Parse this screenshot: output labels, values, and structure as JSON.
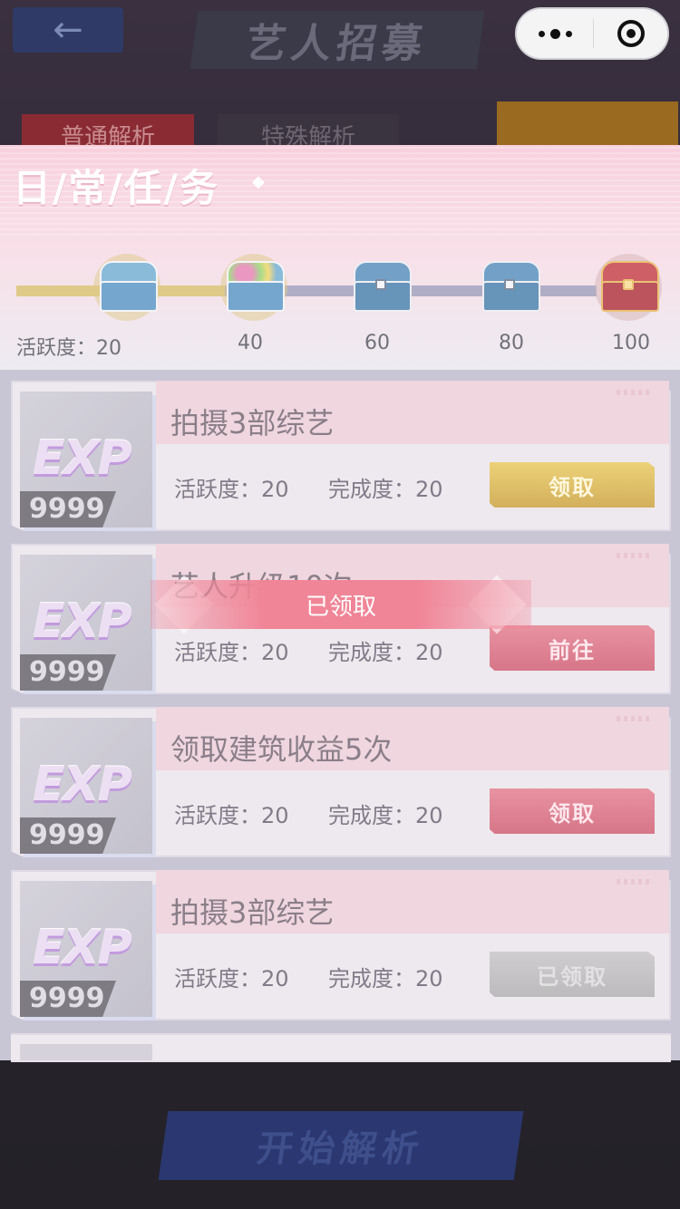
{
  "background": {
    "back_glyph": "←",
    "title": "艺人招募",
    "tab1": "普通解析",
    "tab2": "特殊解析",
    "start_button": "开始解析"
  },
  "capsule": {
    "more_icon": "more-dots-icon",
    "close_icon": "close-target-icon"
  },
  "panel": {
    "title": "日/常/任/务",
    "progress": {
      "label": "活跃度：",
      "levels": [
        "20",
        "40",
        "60",
        "80",
        "100"
      ],
      "fill_fraction": 0.36
    }
  },
  "tasks": [
    {
      "name": "拍摄3部综艺",
      "reward_label": "EXP",
      "amount": "9999",
      "activity": "活跃度：20",
      "completion": "完成度：20",
      "button": "领取",
      "button_style": "gold"
    },
    {
      "name": "艺人升级10次",
      "reward_label": "EXP",
      "amount": "9999",
      "activity": "活跃度：20",
      "completion": "完成度：20",
      "button": "前往",
      "button_style": "red"
    },
    {
      "name": "领取建筑收益5次",
      "reward_label": "EXP",
      "amount": "9999",
      "activity": "活跃度：20",
      "completion": "完成度：20",
      "button": "领取",
      "button_style": "red"
    },
    {
      "name": "拍摄3部综艺",
      "reward_label": "EXP",
      "amount": "9999",
      "activity": "活跃度：20",
      "completion": "完成度：20",
      "button": "已领取",
      "button_style": "gray"
    }
  ],
  "toast": {
    "text": "已领取"
  },
  "colors": {
    "gold": "#d6bc6a",
    "pink": "#f08597",
    "track": "#9a97b6"
  }
}
